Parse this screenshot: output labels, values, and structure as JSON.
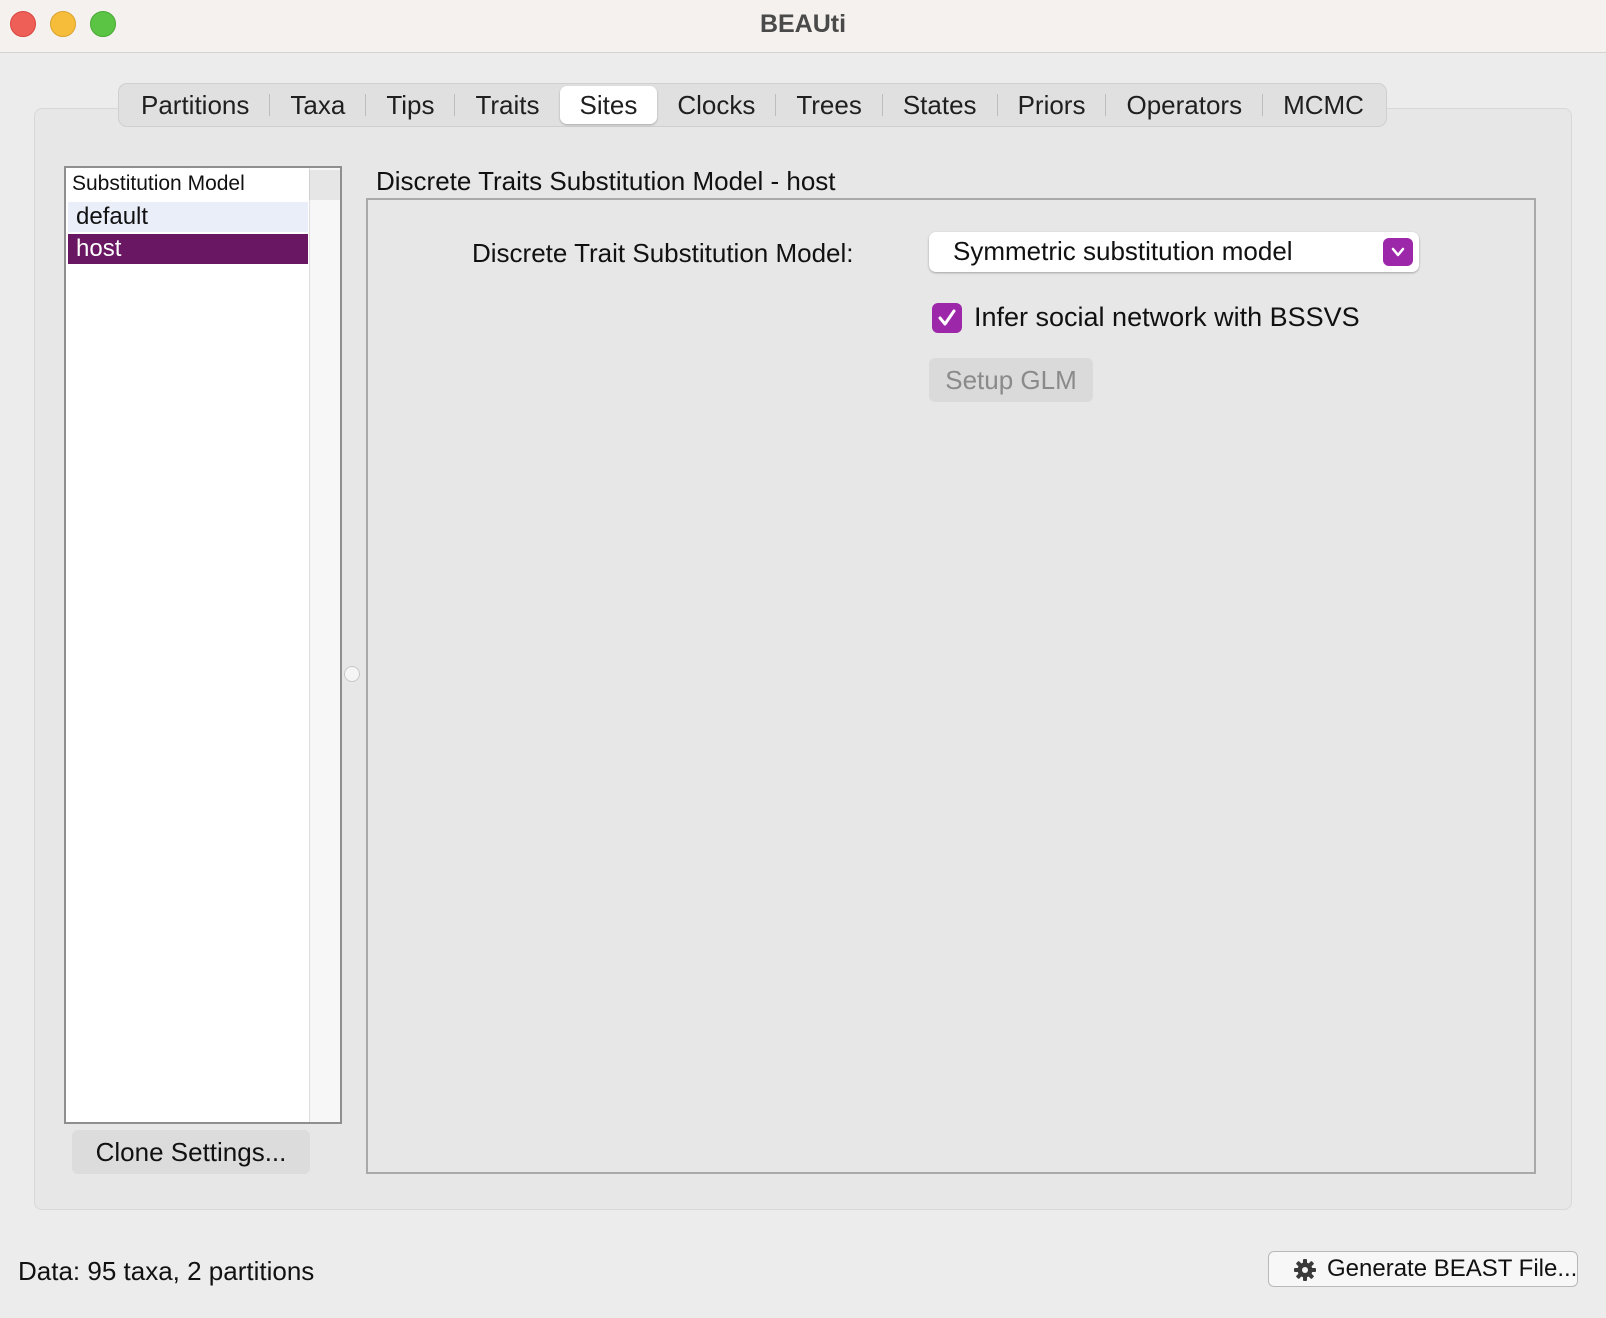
{
  "window": {
    "title": "BEAUti"
  },
  "tabs": [
    {
      "label": "Partitions"
    },
    {
      "label": "Taxa"
    },
    {
      "label": "Tips"
    },
    {
      "label": "Traits"
    },
    {
      "label": "Sites",
      "active": true
    },
    {
      "label": "Clocks"
    },
    {
      "label": "Trees"
    },
    {
      "label": "States"
    },
    {
      "label": "Priors"
    },
    {
      "label": "Operators"
    },
    {
      "label": "MCMC"
    }
  ],
  "sidebar": {
    "header": "Substitution Model",
    "items": [
      {
        "label": "default"
      },
      {
        "label": "host",
        "selected": true
      }
    ],
    "clone_button": "Clone Settings..."
  },
  "panel": {
    "title": "Discrete Traits Substitution Model - host",
    "model_label": "Discrete Trait Substitution Model:",
    "model_value": "Symmetric substitution model",
    "bssvs_label": "Infer social network with BSSVS",
    "bssvs_checked": true,
    "glm_button": "Setup GLM"
  },
  "status": {
    "text": "Data: 95 taxa, 2 partitions",
    "generate_button": "Generate BEAST File..."
  },
  "colors": {
    "accent": "#9c27a8",
    "selection": "#6a1763"
  }
}
